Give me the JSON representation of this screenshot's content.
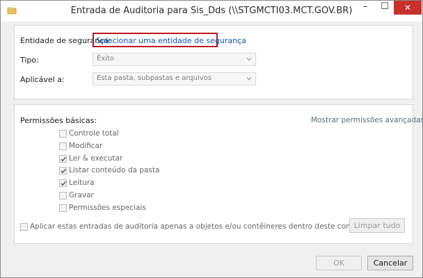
{
  "window": {
    "title": "Entrada de Auditoria para Sis_Dds (\\\\STGMCTI03.MCT.GOV.BR)",
    "controls": {
      "minimize": "–",
      "maximize": "☐",
      "close": "✕"
    },
    "icon": "folder-icon"
  },
  "top_panel": {
    "security_entity_label": "Entidade de segurança:",
    "security_entity_link": "Selecionar uma entidade de segurança",
    "type_label": "Tipo:",
    "type_value": "Êxito",
    "applies_to_label": "Aplicável a:",
    "applies_to_value": "Esta pasta, subpastas e arquivos"
  },
  "permissions": {
    "heading": "Permissões básicas:",
    "advanced_link": "Mostrar permissões avançadas",
    "items": [
      {
        "label": "Controle total",
        "checked": false
      },
      {
        "label": "Modificar",
        "checked": false
      },
      {
        "label": "Ler & executar",
        "checked": true
      },
      {
        "label": "Listar conteúdo da pasta",
        "checked": true
      },
      {
        "label": "Leitura",
        "checked": true
      },
      {
        "label": "Gravar",
        "checked": false
      },
      {
        "label": "Permissões especiais",
        "checked": false
      }
    ],
    "apply_only_label": "Aplicar estas entradas de auditoria apenas a objetos e/ou contêineres dentro deste contêiner",
    "apply_only_checked": false,
    "clear_all_button": "Limpar tudo"
  },
  "footer": {
    "ok_button": "OK",
    "cancel_button": "Cancelar"
  },
  "colors": {
    "link": "#0a57b6",
    "highlight_border": "#c0151c",
    "close_button": "#c7312a"
  }
}
